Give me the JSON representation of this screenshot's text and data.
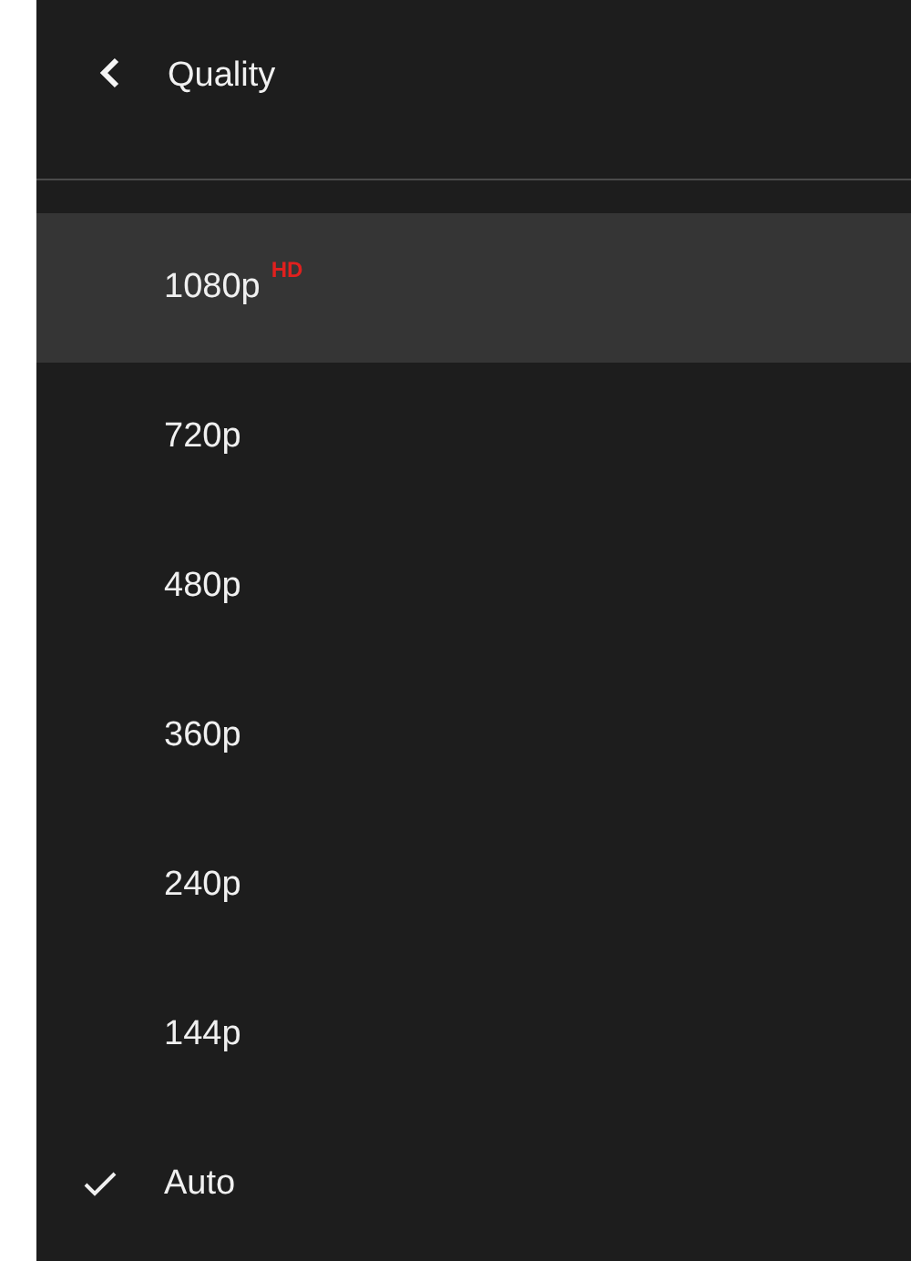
{
  "header": {
    "title": "Quality"
  },
  "options": [
    {
      "label": "1080p",
      "badge": "HD",
      "highlighted": true,
      "selected": false
    },
    {
      "label": "720p",
      "highlighted": false,
      "selected": false
    },
    {
      "label": "480p",
      "highlighted": false,
      "selected": false
    },
    {
      "label": "360p",
      "highlighted": false,
      "selected": false
    },
    {
      "label": "240p",
      "highlighted": false,
      "selected": false
    },
    {
      "label": "144p",
      "highlighted": false,
      "selected": false
    },
    {
      "label": "Auto",
      "highlighted": false,
      "selected": true
    }
  ]
}
